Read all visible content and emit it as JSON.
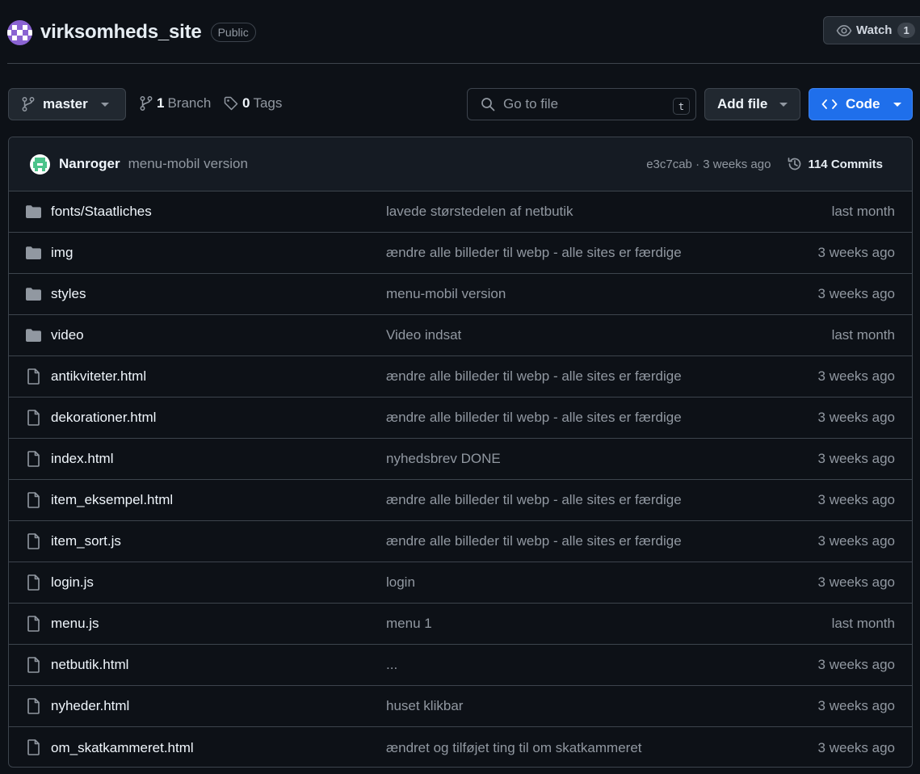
{
  "repo": {
    "name": "virksomheds_site",
    "visibility": "Public",
    "avatar_icon": "identicon-avatar"
  },
  "watch": {
    "label": "Watch",
    "count": "1",
    "icon": "eye-icon"
  },
  "toolbar": {
    "branch_label": "master",
    "branch_count": "1",
    "branch_word": "Branch",
    "tag_count": "0",
    "tag_word": "Tags",
    "search_placeholder": "Go to file",
    "search_shortcut": "t",
    "add_file_label": "Add file",
    "code_label": "Code"
  },
  "commit": {
    "author": "Nanroger",
    "message": "menu-mobil version",
    "hash_time": "e3c7cab · 3 weeks ago",
    "commits_label": "114 Commits"
  },
  "files": [
    {
      "type": "folder",
      "name": "fonts/Staatliches",
      "message": "lavede størstedelen af netbutik",
      "date": "last month"
    },
    {
      "type": "folder",
      "name": "img",
      "message": "ændre alle billeder til webp - alle sites er færdige",
      "date": "3 weeks ago"
    },
    {
      "type": "folder",
      "name": "styles",
      "message": "menu-mobil version",
      "date": "3 weeks ago"
    },
    {
      "type": "folder",
      "name": "video",
      "message": "Video indsat",
      "date": "last month"
    },
    {
      "type": "file",
      "name": "antikviteter.html",
      "message": "ændre alle billeder til webp - alle sites er færdige",
      "date": "3 weeks ago"
    },
    {
      "type": "file",
      "name": "dekorationer.html",
      "message": "ændre alle billeder til webp - alle sites er færdige",
      "date": "3 weeks ago"
    },
    {
      "type": "file",
      "name": "index.html",
      "message": "nyhedsbrev DONE",
      "date": "3 weeks ago"
    },
    {
      "type": "file",
      "name": "item_eksempel.html",
      "message": "ændre alle billeder til webp - alle sites er færdige",
      "date": "3 weeks ago"
    },
    {
      "type": "file",
      "name": "item_sort.js",
      "message": "ændre alle billeder til webp - alle sites er færdige",
      "date": "3 weeks ago"
    },
    {
      "type": "file",
      "name": "login.js",
      "message": "login",
      "date": "3 weeks ago"
    },
    {
      "type": "file",
      "name": "menu.js",
      "message": "menu 1",
      "date": "last month"
    },
    {
      "type": "file",
      "name": "netbutik.html",
      "message": "...",
      "date": "3 weeks ago"
    },
    {
      "type": "file",
      "name": "nyheder.html",
      "message": "huset klikbar",
      "date": "3 weeks ago"
    },
    {
      "type": "file",
      "name": "om_skatkammeret.html",
      "message": "ændret og tilføjet ting til om skatkammeret",
      "date": "3 weeks ago"
    }
  ],
  "colors": {
    "background": "#0d1117",
    "border": "#3d444d",
    "accent_button": "#1f6feb",
    "muted_text": "#9198a1"
  }
}
